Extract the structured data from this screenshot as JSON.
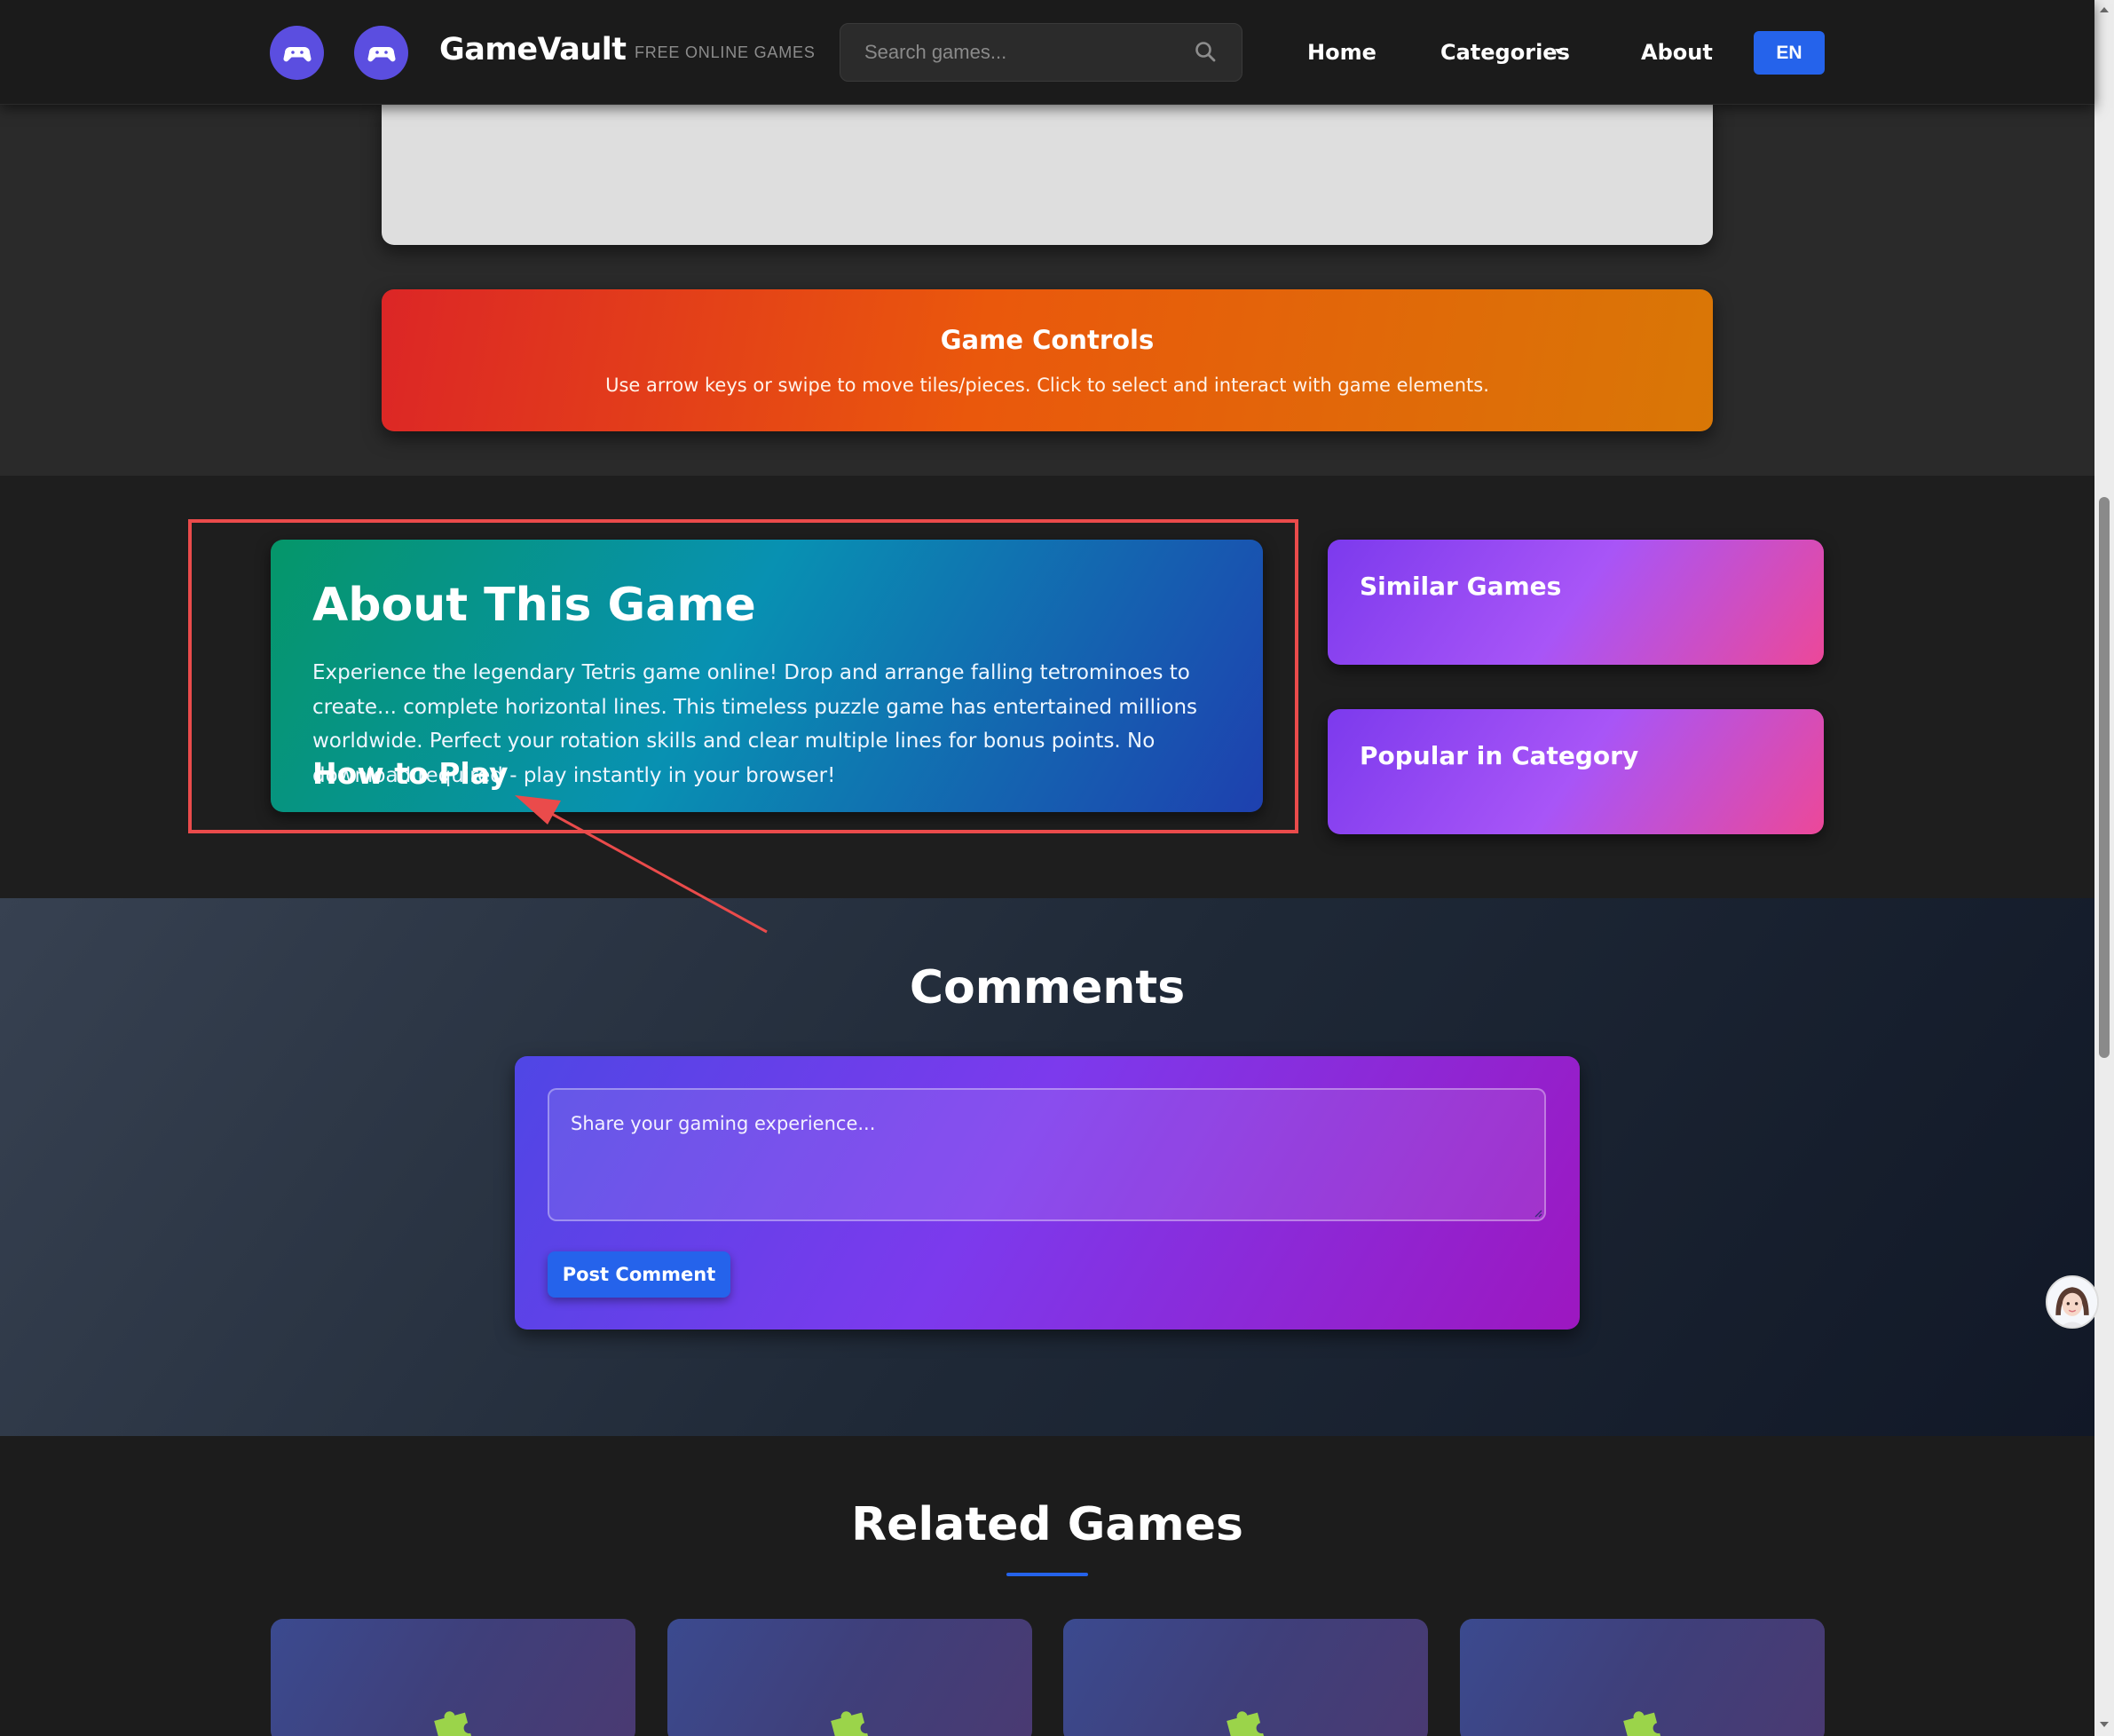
{
  "header": {
    "brand": "GameVault",
    "tagline": "FREE ONLINE GAMES",
    "search_placeholder": "Search games...",
    "nav": {
      "home": "Home",
      "categories": "Categories",
      "about": "About"
    },
    "lang": "EN"
  },
  "game_controls": {
    "title": "Game Controls",
    "text": "Use arrow keys or swipe to move tiles/pieces. Click to select and interact with game elements."
  },
  "about": {
    "title": "About This Game",
    "text": "Experience the legendary Tetris game online! Drop and arrange falling tetrominoes to create... complete horizontal lines. This timeless puzzle game has entertained millions worldwide. Perfect your rotation skills and clear multiple lines for bonus points. No download required - play instantly in your browser!",
    "how_to_play": "How to Play"
  },
  "sidebar": {
    "similar_games": "Similar Games",
    "popular_in_category": "Popular in Category"
  },
  "comments": {
    "title": "Comments",
    "placeholder": "Share your gaming experience...",
    "post_button": "Post Comment"
  },
  "related": {
    "title": "Related Games",
    "cards": [
      {
        "icon": "puzzle-piece-icon"
      },
      {
        "icon": "puzzle-piece-icon"
      },
      {
        "icon": "puzzle-piece-icon"
      },
      {
        "icon": "puzzle-piece-icon"
      }
    ]
  },
  "colors": {
    "accent_blue": "#2563eb",
    "logo_purple": "#5b4ee0",
    "annotation_red": "#ea4b4b"
  }
}
